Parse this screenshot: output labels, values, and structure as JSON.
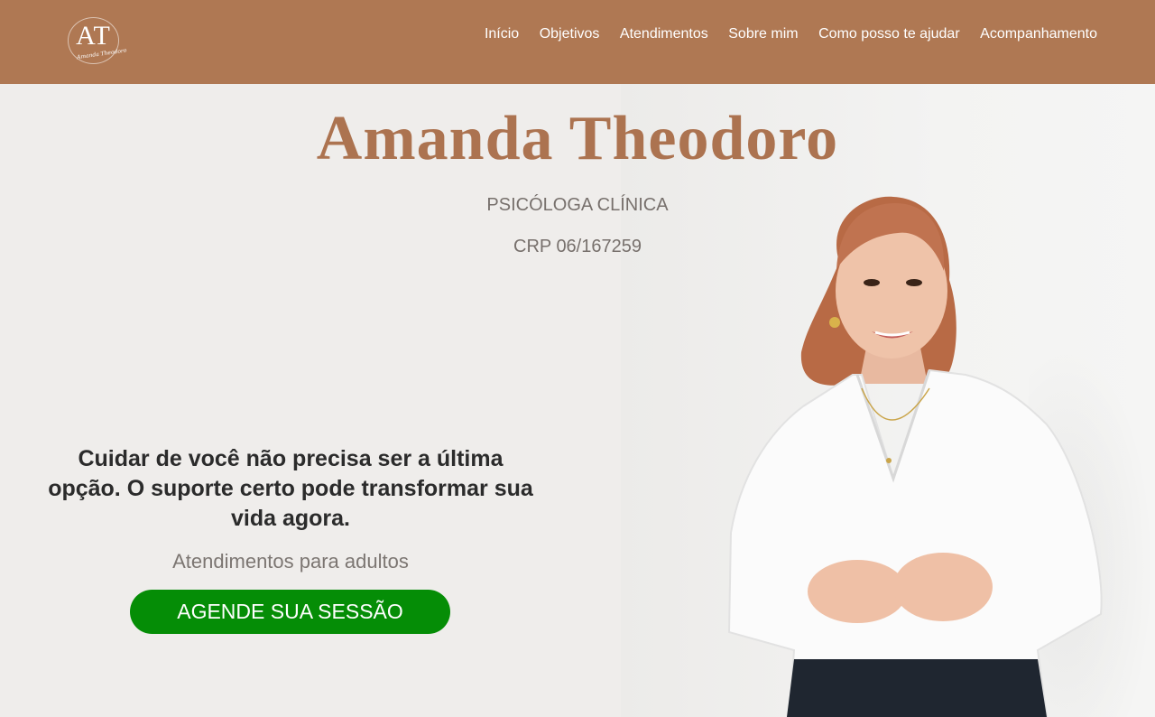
{
  "header": {
    "logo_monogram": "AT",
    "logo_signature": "Amanda Theodoro",
    "nav": [
      {
        "label": "Início"
      },
      {
        "label": "Objetivos"
      },
      {
        "label": "Atendimentos"
      },
      {
        "label": "Sobre mim"
      },
      {
        "label": "Como posso te ajudar"
      },
      {
        "label": "Acompanhamento"
      }
    ]
  },
  "hero": {
    "name": "Amanda Theodoro",
    "role": "PSICÓLOGA CLÍNICA",
    "crp": "CRP 06/167259",
    "tagline": "Cuidar de você não precisa ser a última opção. O suporte certo pode transformar sua vida agora.",
    "audience": "Atendimentos para adultos",
    "cta_label": "AGENDE SUA SESSÃO"
  },
  "colors": {
    "header_bg": "#af7853",
    "accent_brown": "#ac7350",
    "cta_green": "#058d06",
    "page_bg": "#efedeb"
  },
  "icons": {
    "logo": "monogram-logo",
    "photo": "portrait-photo"
  }
}
